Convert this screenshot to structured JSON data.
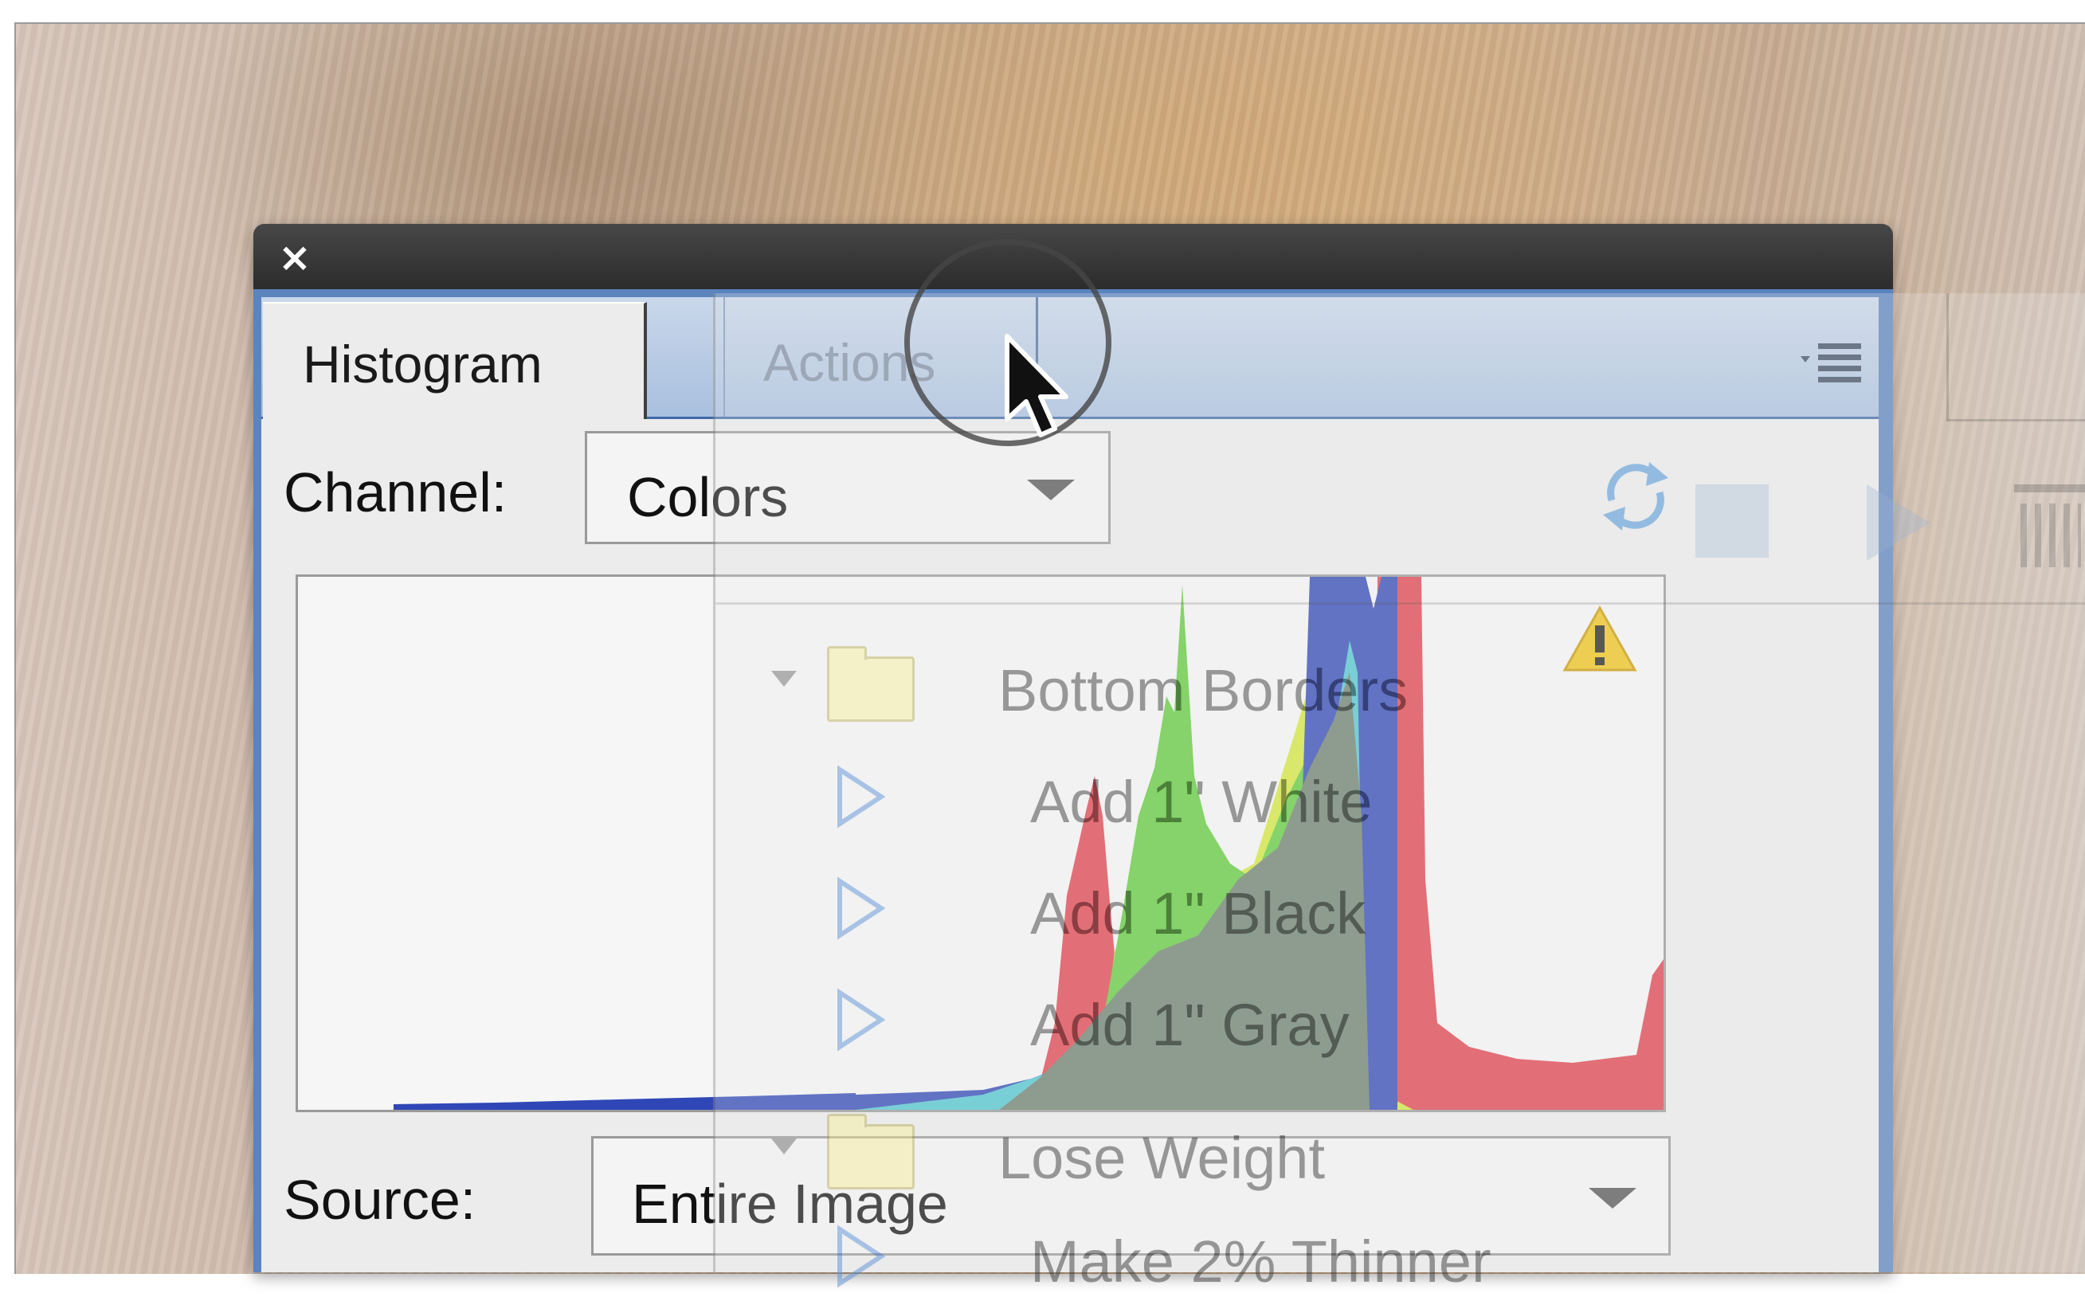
{
  "window": {
    "close_glyph": "×"
  },
  "tabs": [
    {
      "label": "Histogram",
      "active": true
    },
    {
      "label": "Actions",
      "active": false
    }
  ],
  "panel_menu_icon": "panel-menu-icon",
  "channel": {
    "label": "Channel:",
    "value": "Colors"
  },
  "histogram": {
    "warning_icon": "warning-icon",
    "colors": {
      "red": "#e0414c",
      "green": "#5fcb3a",
      "blue": "#2f47b6",
      "cyan": "#4fc6cf",
      "yellow": "#d3e83a",
      "gray": "#6c7f6d"
    }
  },
  "source": {
    "label": "Source:",
    "value": "Entire Image"
  },
  "actions_ghost": {
    "items": [
      {
        "type": "folder",
        "label": "Bottom Borders"
      },
      {
        "type": "action",
        "label": "Add 1\" White"
      },
      {
        "type": "action",
        "label": "Add 1\" Black"
      },
      {
        "type": "action",
        "label": "Add 1\" Gray"
      },
      {
        "type": "folder",
        "label": "Lose Weight"
      },
      {
        "type": "action",
        "label": "Make 2% Thinner"
      }
    ]
  }
}
